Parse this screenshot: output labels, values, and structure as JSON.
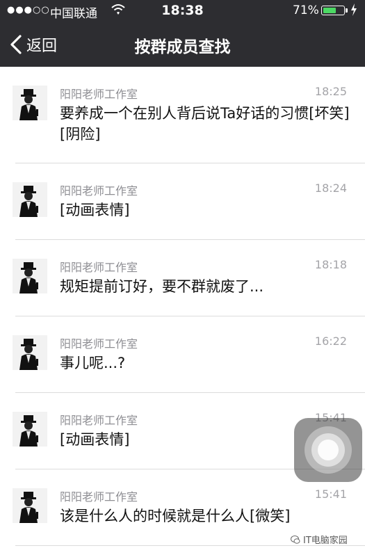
{
  "status_bar": {
    "signal": "●●●○○",
    "carrier": "中国联通",
    "time": "18:38",
    "battery_percent": "71%",
    "battery_level": 0.71,
    "battery_color": "#4cd964"
  },
  "nav": {
    "back_label": "返回",
    "title": "按群成员查找",
    "background": "#2d2d31"
  },
  "messages": [
    {
      "sender": "阳阳老师工作室",
      "time": "18:25",
      "text": "要养成一个在别人背后说Ta好话的习惯[坏笑][阴险]"
    },
    {
      "sender": "阳阳老师工作室",
      "time": "18:24",
      "text": "[动画表情]"
    },
    {
      "sender": "阳阳老师工作室",
      "time": "18:18",
      "text": "规矩提前订好，要不群就废了..."
    },
    {
      "sender": "阳阳老师工作室",
      "time": "16:22",
      "text": "事儿呢...?"
    },
    {
      "sender": "阳阳老师工作室",
      "time": "15:41",
      "text": "[动画表情]"
    },
    {
      "sender": "阳阳老师工作室",
      "time": "15:41",
      "text": "该是什么人的时候就是什么人[微笑]"
    }
  ],
  "watermark": {
    "icon": "wechat-bubble-icon",
    "text": "IT电脑家园"
  }
}
